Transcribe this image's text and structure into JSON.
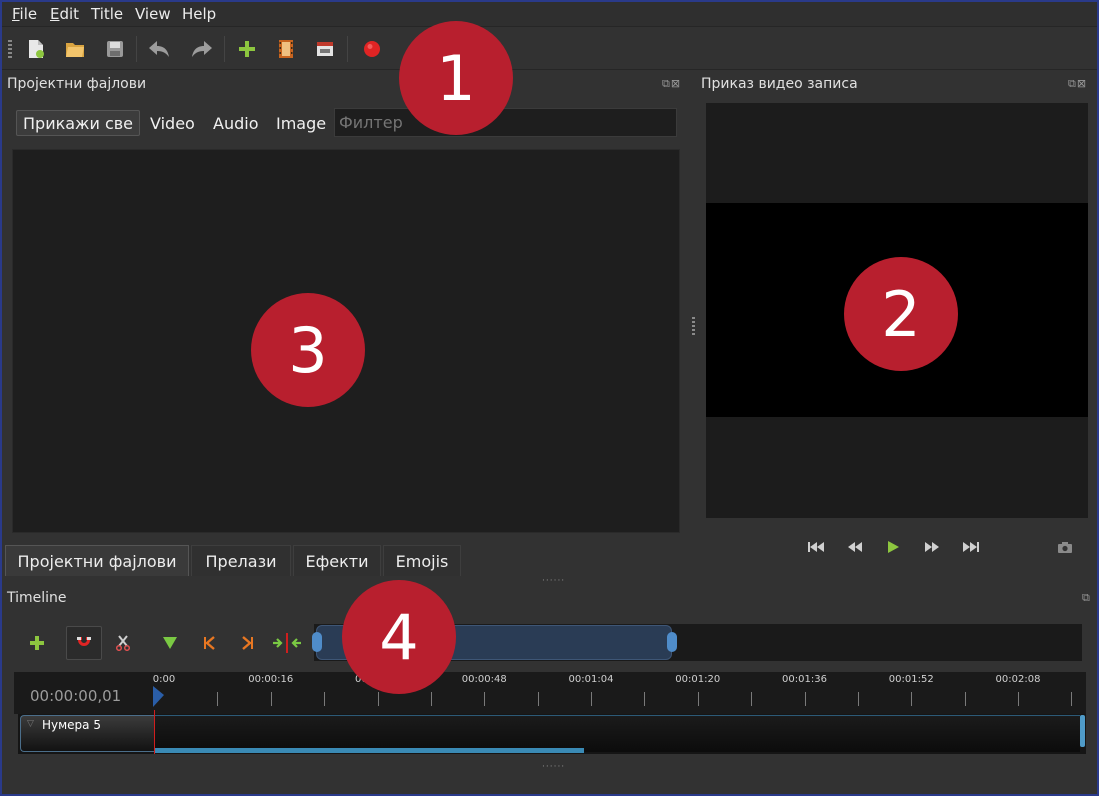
{
  "menu": {
    "items": [
      {
        "label": "File",
        "accel": "F"
      },
      {
        "label": "Edit",
        "accel": "E"
      },
      {
        "label": "Title",
        "accel": ""
      },
      {
        "label": "View",
        "accel": ""
      },
      {
        "label": "Help",
        "accel": ""
      }
    ]
  },
  "toolbar": {
    "buttons": [
      "new-project-icon",
      "open-project-icon",
      "save-project-icon",
      "undo-icon",
      "redo-icon",
      "import-files-icon",
      "choose-profile-icon",
      "fullscreen-icon",
      "export-video-icon"
    ]
  },
  "project_files": {
    "title": "Пројектни фајлови",
    "filters": [
      "Прикажи све",
      "Video",
      "Audio",
      "Image"
    ],
    "filter_placeholder": "Филтер"
  },
  "bottom_tabs": [
    "Пројектни фајлови",
    "Прелази",
    "Ефекти",
    "Emojis"
  ],
  "preview": {
    "title": "Приказ видео записа",
    "controls": [
      "jump-start-icon",
      "rewind-icon",
      "play-icon",
      "fast-forward-icon",
      "jump-end-icon",
      "snapshot-icon"
    ]
  },
  "timeline": {
    "title": "Timeline",
    "timecode": "00:00:00,01",
    "ticks": [
      "0:00",
      "00:00:16",
      "00:00:32",
      "00:00:48",
      "00:01:04",
      "00:01:20",
      "00:01:36",
      "00:01:52",
      "00:02:08"
    ],
    "track_name": "Нумера 5"
  },
  "annotations": [
    "1",
    "2",
    "3",
    "4"
  ],
  "colors": {
    "badge": "#b81f2e",
    "accent_blue": "#4f8cc9",
    "playhead": "#d01e1e",
    "add_green": "#8dc63f"
  }
}
